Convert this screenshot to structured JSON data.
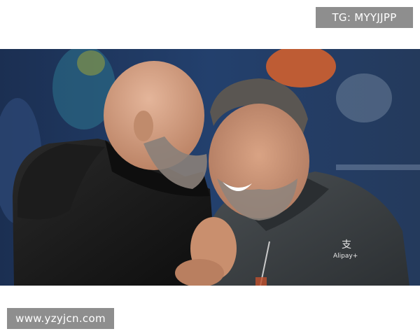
{
  "watermark_top": {
    "text": "TG: MYYJJPP"
  },
  "watermark_bottom": {
    "text": "www.yzyjcn.com"
  },
  "photo": {
    "description_icon": "photo-two-men-embracing-stadium",
    "jacket_logo_text": "Alipay+",
    "colors": {
      "background_blue": "#1f3a63",
      "jacket_black": "#151515",
      "jacket_grey": "#3b3f42",
      "skin": "#c79274"
    }
  }
}
